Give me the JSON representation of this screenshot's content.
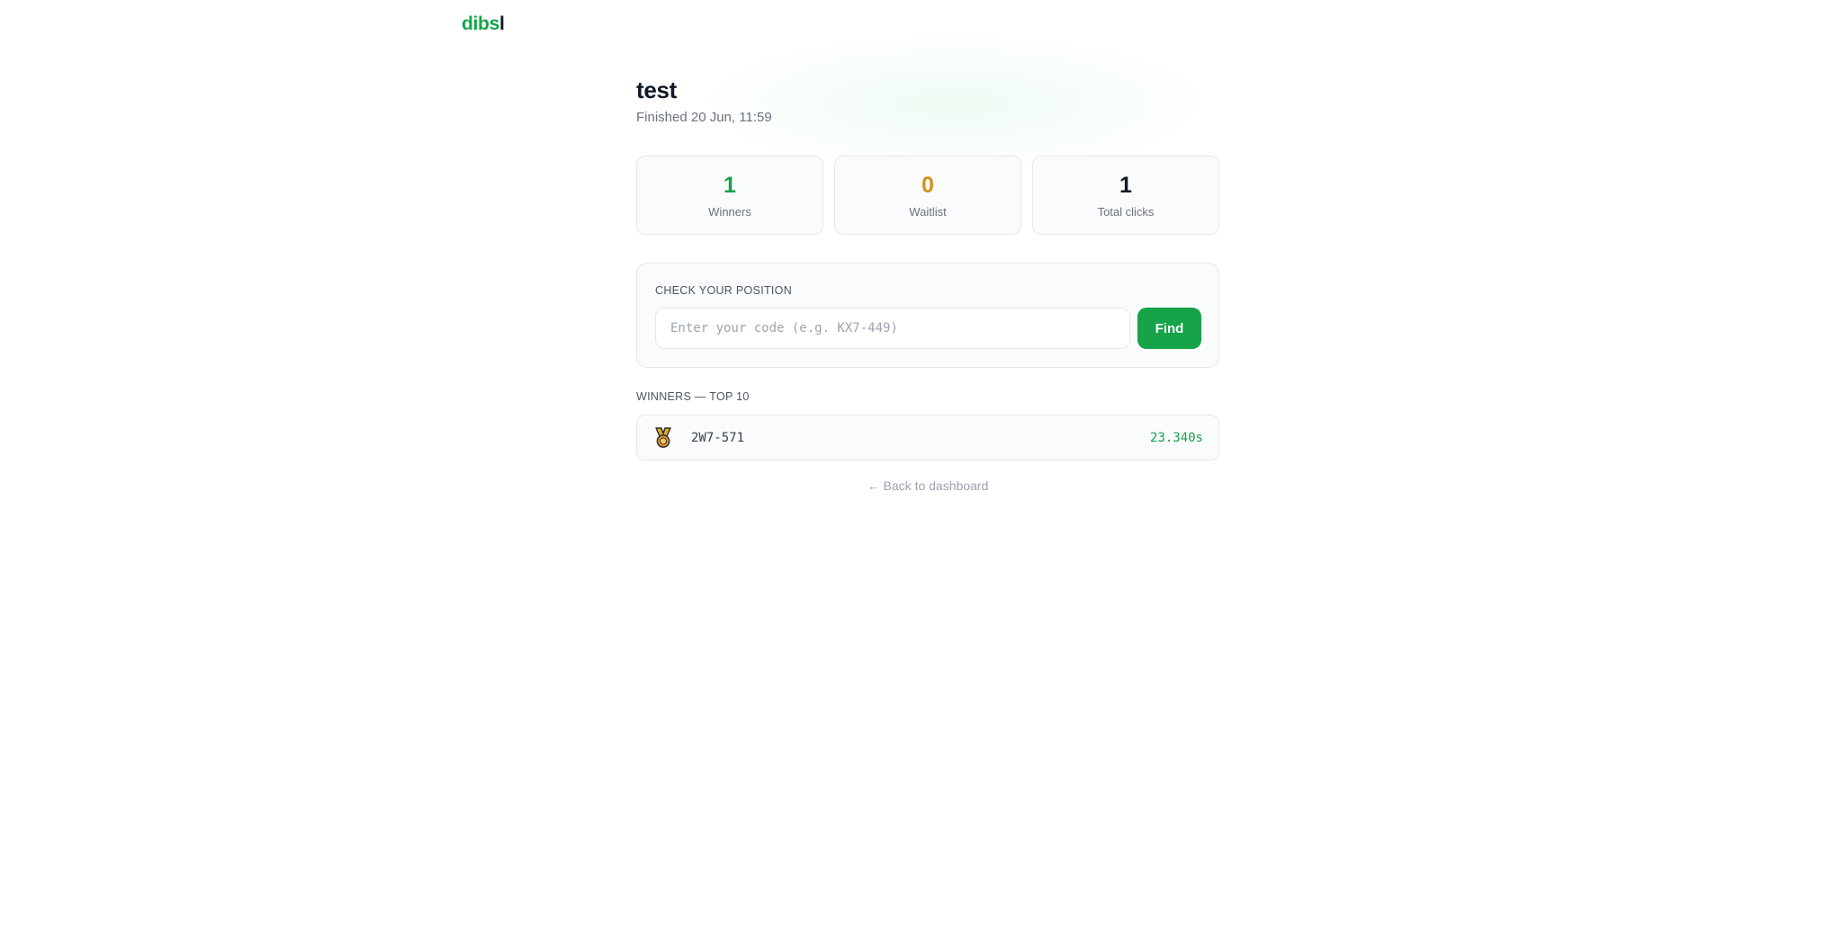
{
  "brand": {
    "logo_main": "dibs",
    "logo_accent": "l"
  },
  "header": {
    "title": "test",
    "subtitle": "Finished 20 Jun, 11:59"
  },
  "stats": [
    {
      "value": "1",
      "label": "Winners",
      "color": "#16a34a"
    },
    {
      "value": "0",
      "label": "Waitlist",
      "color": "#d4911c"
    },
    {
      "value": "1",
      "label": "Total clicks",
      "color": "#111827"
    }
  ],
  "check": {
    "title": "CHECK YOUR POSITION",
    "placeholder": "Enter your code (e.g. KX7-449)",
    "value": "",
    "button_label": "Find"
  },
  "winners": {
    "title": "WINNERS — TOP 10",
    "rows": [
      {
        "icon": "medal-icon",
        "code": "2W7-571",
        "time": "23.340s"
      }
    ]
  },
  "footer": {
    "back_label": "← Back to dashboard"
  },
  "colors": {
    "accent": "#16a34a",
    "waitlist": "#d4911c",
    "border": "#e5e7eb"
  }
}
